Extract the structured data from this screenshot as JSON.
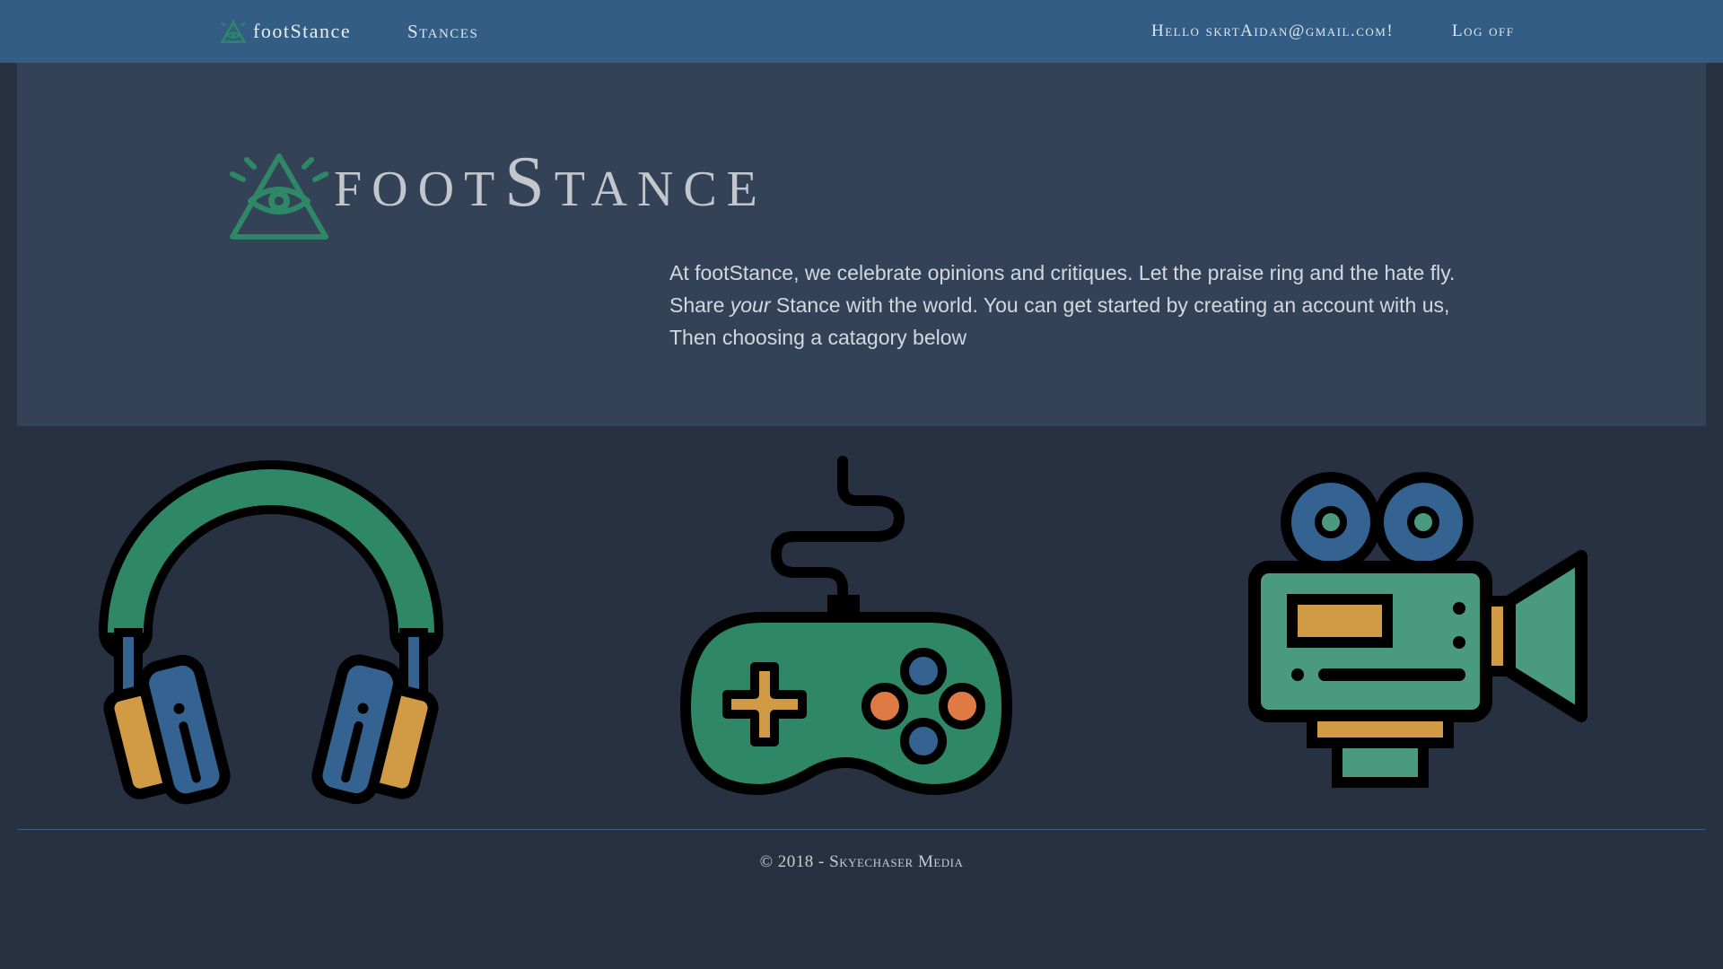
{
  "navbar": {
    "brand": "footStance",
    "brand_icon": "eye-triangle-icon",
    "links": {
      "stances": "Stances"
    },
    "greeting": "Hello skrtAidan@gmail.com!",
    "logoff": "Log off"
  },
  "hero": {
    "title": "footStance",
    "logo_icon": "eye-triangle-icon",
    "text_line1": "At footStance, we celebrate opinions and critiques. Let the praise ring and the hate fly.",
    "text_share": "Share",
    "text_your": "your",
    "text_line2_rest": "Stance with the world. You can get started by creating an account with us,",
    "text_line3": "Then choosing a catagory below"
  },
  "categories": [
    {
      "icon": "headphones-icon"
    },
    {
      "icon": "gamepad-icon"
    },
    {
      "icon": "movie-camera-icon"
    }
  ],
  "footer": {
    "copyright": "© 2018 - Skyechaser Media"
  },
  "colors": {
    "navbar": "#345d85",
    "background": "#273141",
    "jumbotron": "#334256",
    "green": "#2e8767",
    "blue": "#346291",
    "orange": "#d19b45"
  }
}
